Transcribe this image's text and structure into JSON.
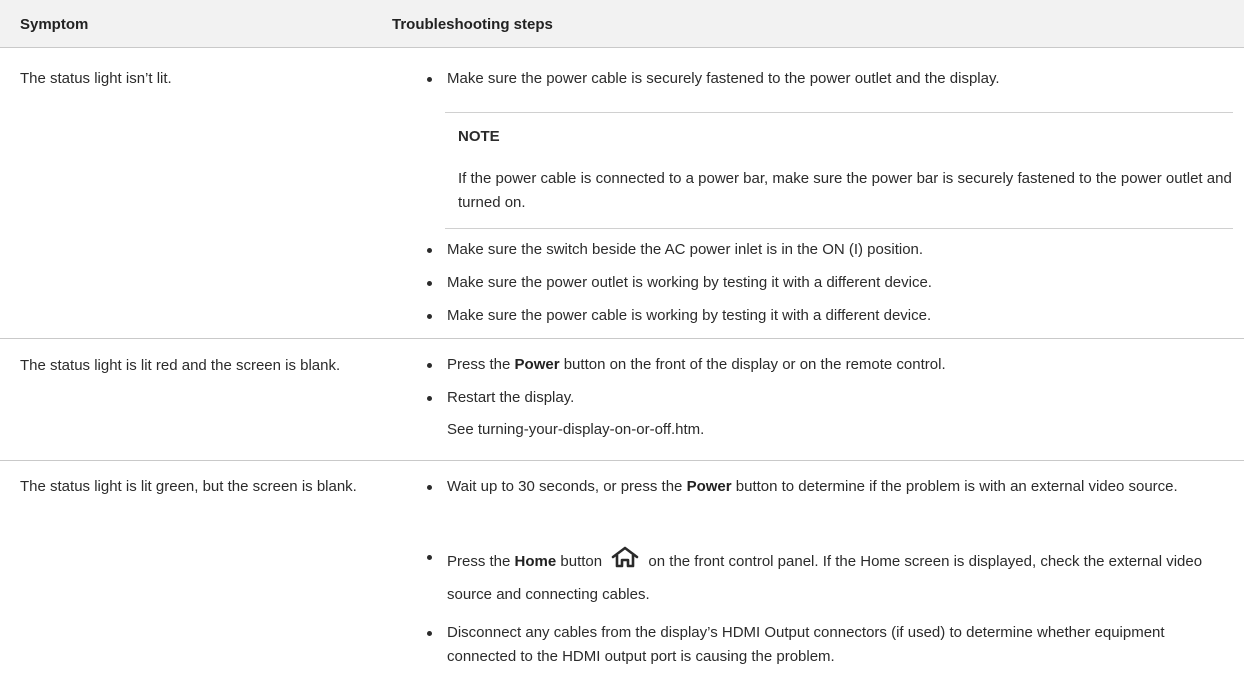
{
  "table": {
    "headers": {
      "symptom": "Symptom",
      "steps": "Troubleshooting steps"
    },
    "rows": [
      {
        "symptom": "The status light isn’t lit.",
        "steps": [
          "Make sure the power cable is securely fastened to the power outlet and the display.",
          "Make sure the switch beside the AC power inlet is in the ON (I) position.",
          "Make sure the power outlet is working by testing it with a different device.",
          "Make sure the power cable is working by testing it with a different device."
        ],
        "note": {
          "title": "NOTE",
          "text": "If the power cable is connected to a power bar, make sure the power bar is securely fastened to the power outlet and turned on."
        }
      },
      {
        "symptom": "The status light is lit red and the screen is blank.",
        "steps": [
          {
            "before": "Press the ",
            "bold": "Power",
            "after": " button on the front of the display or on the remote control."
          },
          "Restart the display."
        ],
        "see_also": "See turning-your-display-on-or-off.htm."
      },
      {
        "symptom": "The status light is lit green, but the screen is blank.",
        "steps": [
          {
            "before": "Wait up to 30 seconds, or press the ",
            "bold": "Power",
            "after": " button to determine if the problem is with an external video source."
          },
          {
            "before": "Press the ",
            "bold": "Home",
            "mid": " button ",
            "icon": "home-icon",
            "after": " on the front control panel. If the Home screen is displayed, check the external video source and connecting cables."
          },
          "Disconnect any cables from the display’s HDMI Output connectors (if used) to determine whether equipment connected to the HDMI output port is causing the problem."
        ]
      }
    ]
  }
}
